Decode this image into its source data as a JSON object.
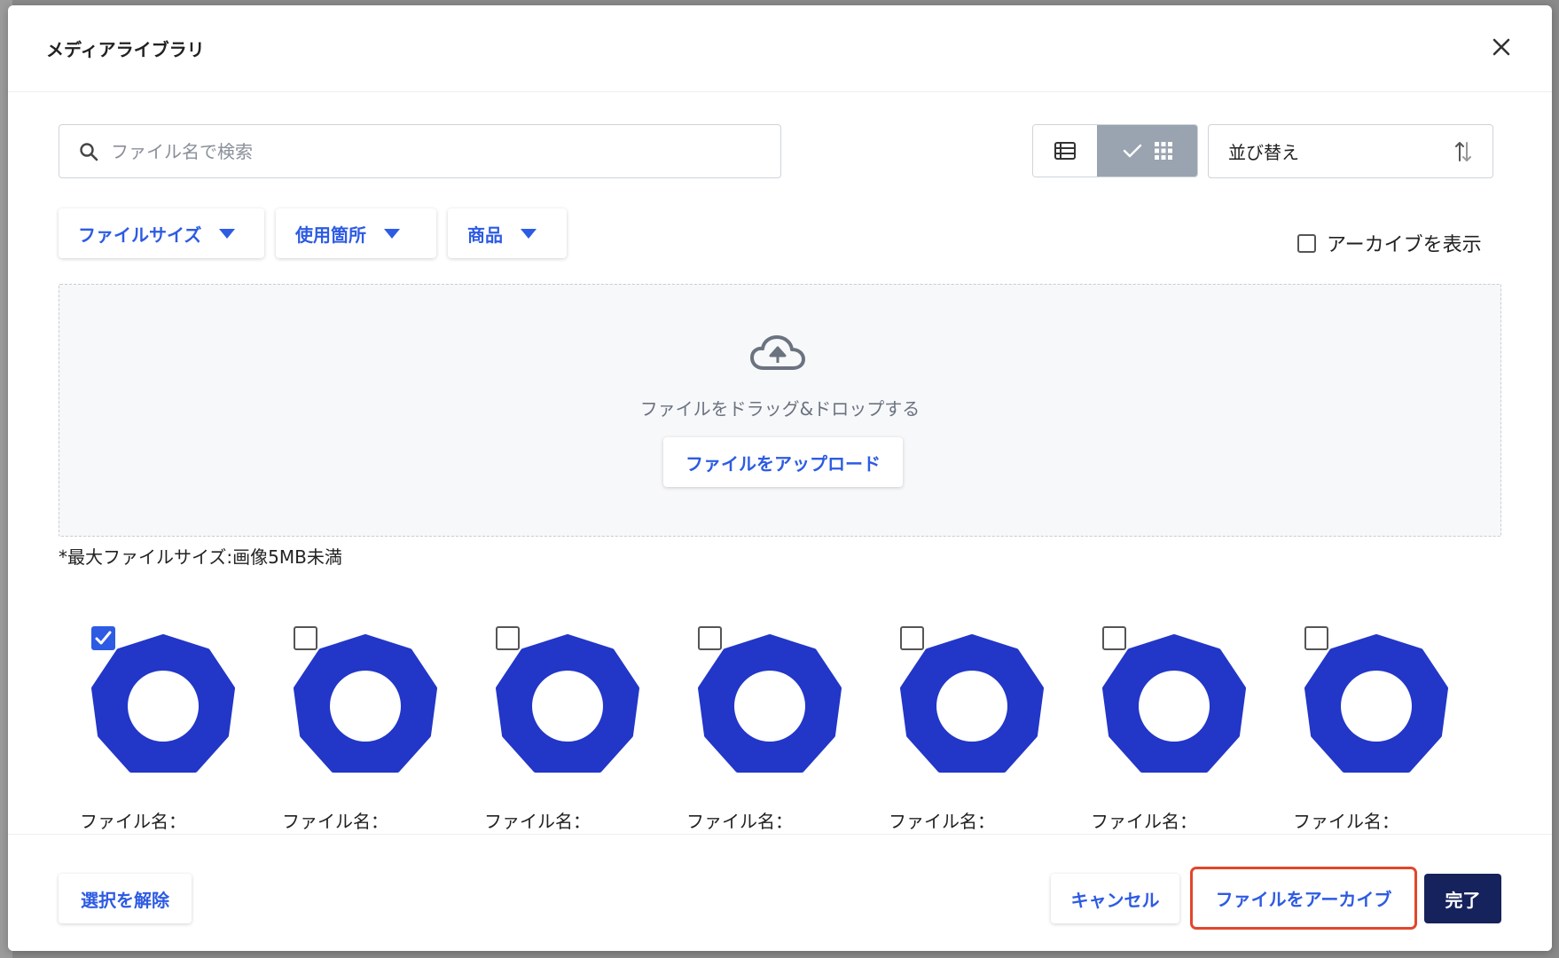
{
  "modal": {
    "title": "メディアライブラリ"
  },
  "search": {
    "placeholder": "ファイル名で検索",
    "value": ""
  },
  "view_toggle": {
    "selected": "grid"
  },
  "sort": {
    "label": "並び替え"
  },
  "filters": [
    {
      "label": "ファイルサイズ"
    },
    {
      "label": "使用箇所"
    },
    {
      "label": "商品"
    }
  ],
  "archive_toggle": {
    "label": "アーカイブを表示",
    "checked": false
  },
  "dropzone": {
    "text": "ファイルをドラッグ&ドロップする",
    "upload_label": "ファイルをアップロード"
  },
  "max_size_note": "*最大ファイルサイズ:画像5MB未満",
  "files": [
    {
      "name": "ファイル名：",
      "checked": true
    },
    {
      "name": "ファイル名：",
      "checked": false
    },
    {
      "name": "ファイル名：",
      "checked": false
    },
    {
      "name": "ファイル名：",
      "checked": false
    },
    {
      "name": "ファイル名：",
      "checked": false
    },
    {
      "name": "ファイル名：",
      "checked": false
    },
    {
      "name": "ファイル名：",
      "checked": false
    }
  ],
  "footer": {
    "deselect_label": "選択を解除",
    "cancel_label": "キャンセル",
    "archive_label": "ファイルをアーカイブ",
    "done_label": "完了"
  },
  "colors": {
    "accent": "#2d5be3",
    "primary": "#15225c",
    "thumbnail": "#2236c8",
    "highlight": "#e2462a"
  }
}
